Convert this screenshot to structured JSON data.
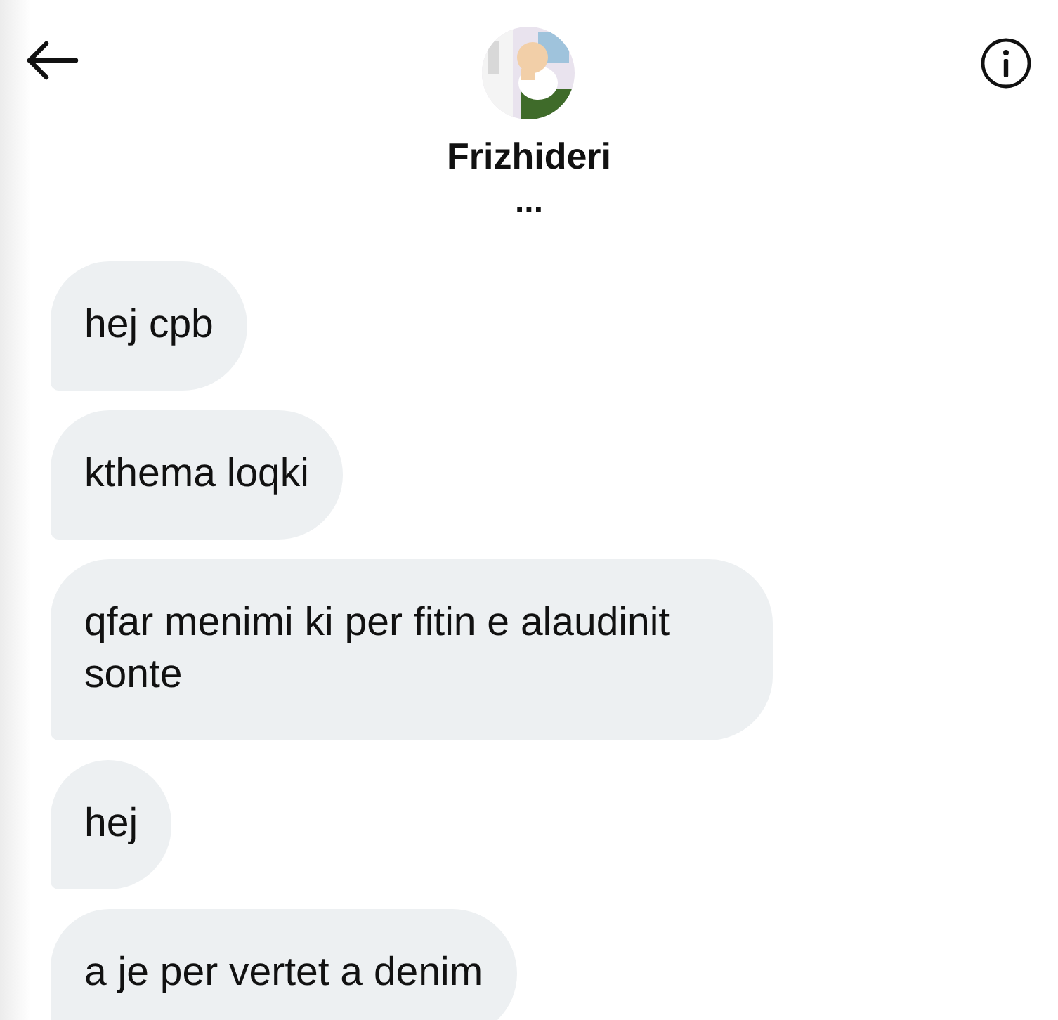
{
  "header": {
    "name": "Frizhideri",
    "status": "..."
  },
  "messages": [
    {
      "text": "hej cpb"
    },
    {
      "text": "kthema loqki"
    },
    {
      "text": "qfar menimi ki per fitin e alaudinit sonte"
    },
    {
      "text": "hej"
    },
    {
      "text": "a je per vertet a denim"
    }
  ]
}
